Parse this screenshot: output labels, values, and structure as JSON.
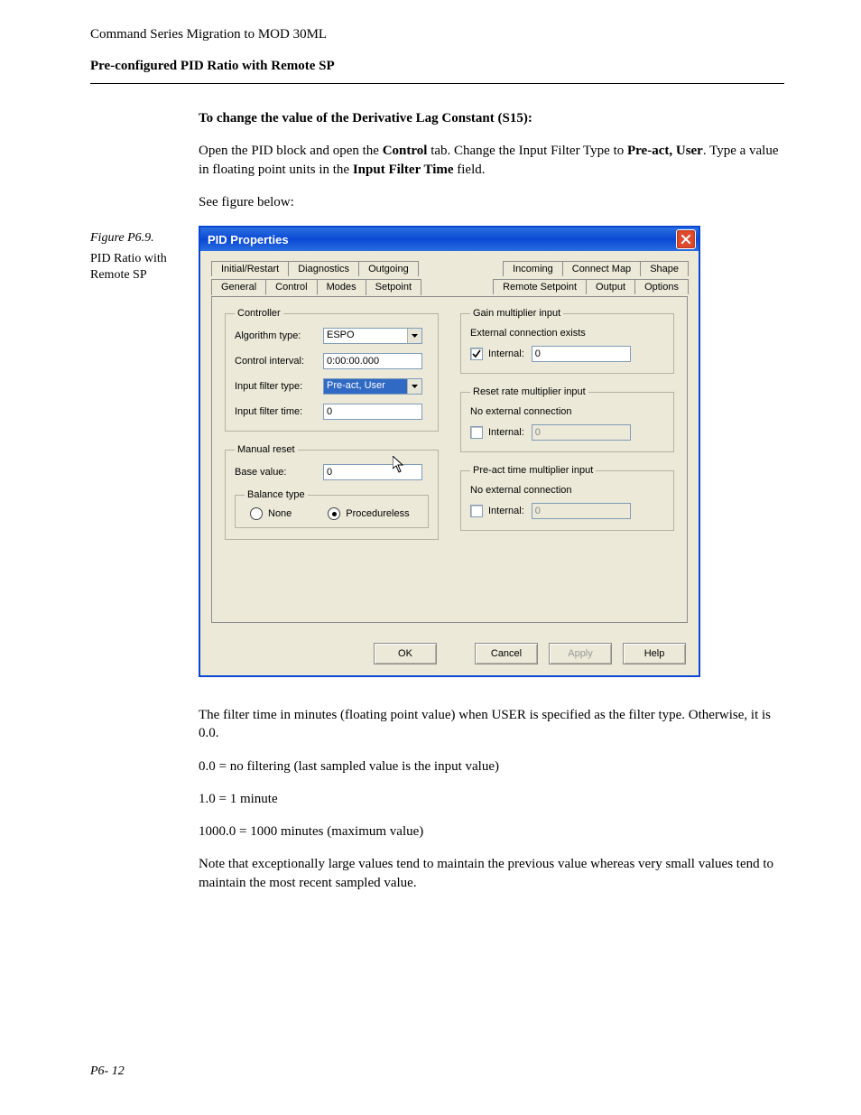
{
  "doc": {
    "header": "Command Series Migration to MOD 30ML",
    "subheader": "Pre-configured PID Ratio with Remote SP",
    "section_title": "To change the value of the Derivative Lag Constant (S15):",
    "para1_prefix": "Open the PID block and open the ",
    "para1_b1": "Control",
    "para1_mid1": " tab. Change the Input Filter Type to ",
    "para1_b2": "Pre-act, User",
    "para1_mid2": ". Type a value in floating point units in the ",
    "para1_b3": "Input Filter Time",
    "para1_suffix": " field.",
    "see_fig": "See figure below:",
    "fig_label": "Figure P6.9.",
    "fig_caption": "PID Ratio with Remote SP",
    "after1": "The filter time in minutes (floating point value) when USER is specified as the filter type. Otherwise, it is 0.0.",
    "after2": "0.0 = no filtering (last sampled value is the input value)",
    "after3": "1.0 = 1 minute",
    "after4": "1000.0 = 1000 minutes (maximum value)",
    "after5": "Note that exceptionally large values tend to maintain the previous value whereas very small values tend to maintain the most recent sampled value.",
    "page_num": "P6- 12"
  },
  "dialog": {
    "title": "PID Properties",
    "tabs_row1_left": [
      "Initial/Restart",
      "Diagnostics",
      "Outgoing"
    ],
    "tabs_row1_right": [
      "Incoming",
      "Connect Map",
      "Shape"
    ],
    "tabs_row2_left": [
      "General",
      "Control",
      "Modes",
      "Setpoint"
    ],
    "tabs_row2_right": [
      "Remote Setpoint",
      "Output",
      "Options"
    ],
    "selected_tab": "Control",
    "controller": {
      "legend": "Controller",
      "algorithm_label": "Algorithm type:",
      "algorithm_value": "ESPO",
      "interval_label": "Control interval:",
      "interval_value": "0:00:00.000",
      "filter_type_label": "Input filter type:",
      "filter_type_value": "Pre-act, User",
      "filter_time_label": "Input filter time:",
      "filter_time_value": "0"
    },
    "manual_reset": {
      "legend": "Manual reset",
      "base_label": "Base value:",
      "base_value": "0",
      "balance_legend": "Balance type",
      "opt_none": "None",
      "opt_proc": "Procedureless"
    },
    "gain": {
      "legend": "Gain multiplier input",
      "status": "External connection exists",
      "internal_label": "Internal:",
      "internal_value": "0"
    },
    "reset": {
      "legend": "Reset rate multiplier input",
      "status": "No external connection",
      "internal_label": "Internal:",
      "internal_value": "0"
    },
    "preact": {
      "legend": "Pre-act time multiplier input",
      "status": "No external connection",
      "internal_label": "Internal:",
      "internal_value": "0"
    },
    "buttons": {
      "ok": "OK",
      "cancel": "Cancel",
      "apply": "Apply",
      "help": "Help"
    }
  }
}
